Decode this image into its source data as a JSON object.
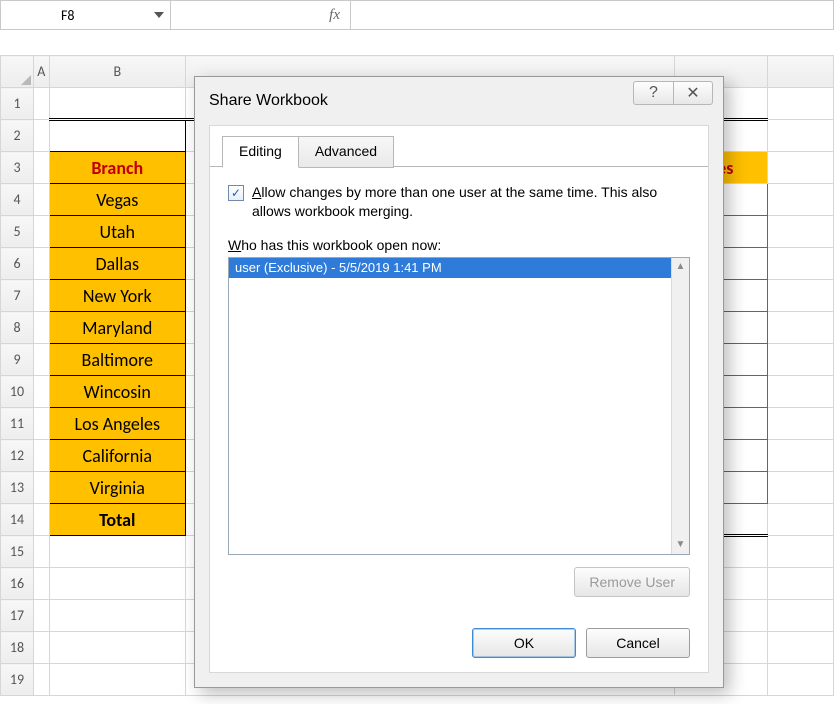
{
  "formula_bar": {
    "namebox_value": "F8",
    "fx_label": "fx"
  },
  "sheet": {
    "col_headers": [
      "A",
      "B"
    ],
    "row_numbers": [
      "1",
      "2",
      "3",
      "4",
      "5",
      "6",
      "7",
      "8",
      "9",
      "10",
      "11",
      "12",
      "13",
      "14",
      "15",
      "16",
      "17",
      "18",
      "19"
    ],
    "header_b": "Branch",
    "header_sales_fragment": "ales",
    "data_b": [
      "Vegas",
      "Utah",
      "Dallas",
      "New York",
      "Maryland",
      "Baltimore",
      "Wincosin",
      "Los Angeles",
      "California",
      "Virginia"
    ],
    "total_label": "Total"
  },
  "dialog": {
    "title": "Share Workbook",
    "help_glyph": "?",
    "close_glyph": "✕",
    "tab_editing": "Editing",
    "tab_advanced": "Advanced",
    "checkbox_label_prefix": "A",
    "checkbox_label_rest": "llow changes by more than one user at the same time.  This also allows workbook merging.",
    "checkbox_checked_glyph": "✓",
    "who_label_prefix": "W",
    "who_label_rest": "ho has this workbook open now:",
    "list_items": [
      "user (Exclusive) - 5/5/2019 1:41 PM"
    ],
    "scroll_up_glyph": "▲",
    "scroll_down_glyph": "▼",
    "remove_user_label": "Remove User",
    "ok_label": "OK",
    "cancel_label": "Cancel"
  }
}
